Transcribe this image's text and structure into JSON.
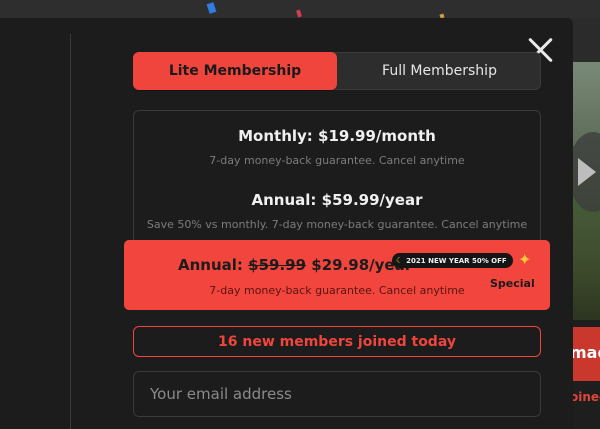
{
  "tabs": {
    "lite_label": "Lite Membership",
    "full_label": "Full Membership"
  },
  "plans": {
    "monthly": {
      "title": "Monthly: $19.99/month",
      "subtitle": "7-day money-back guarantee. Cancel anytime"
    },
    "annual": {
      "title": "Annual: $59.99/year",
      "subtitle": "Save 50% vs monthly. 7-day money-back guarantee. Cancel anytime"
    },
    "special": {
      "title_prefix": "Annual: ",
      "old_price": "$59.99",
      "new_price": " $29.98/year",
      "badge": "2021 NEW YEAR 50% OFF",
      "tag": "Special",
      "subtitle": "7-day money-back guarantee. Cancel anytime"
    }
  },
  "joined_text": "16 new members joined today",
  "email": {
    "placeholder": "Your email address",
    "value": ""
  },
  "background": {
    "button_label": "mad",
    "link_text": "oined"
  },
  "colors": {
    "accent": "#f0453d",
    "modal_bg": "#1c1c1c",
    "badge_bg": "#151515"
  },
  "icons": [
    "close-icon",
    "moon-icon",
    "sparkle-icon",
    "play-icon"
  ]
}
